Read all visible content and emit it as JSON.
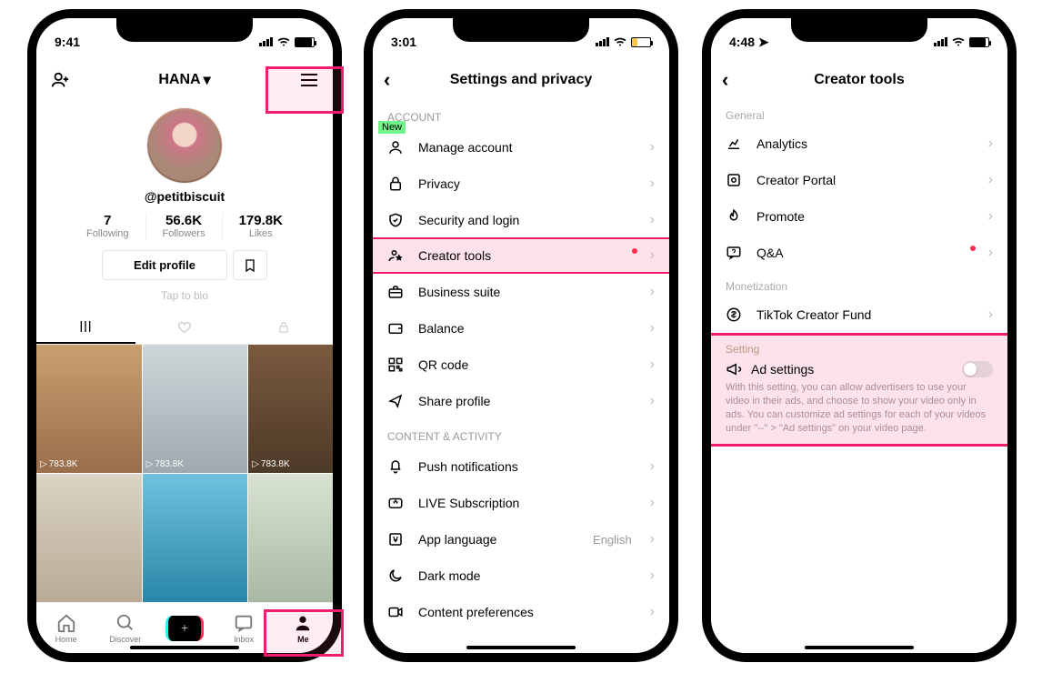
{
  "phone1": {
    "time": "9:41",
    "title": "HANA",
    "username": "@petitbiscuit",
    "stats": {
      "following_num": "7",
      "following_lab": "Following",
      "followers_num": "56.6K",
      "followers_lab": "Followers",
      "likes_num": "179.8K",
      "likes_lab": "Likes"
    },
    "edit_btn": "Edit profile",
    "bio_prompt": "Tap to bio",
    "views": "783.8K",
    "nav": {
      "home": "Home",
      "discover": "Discover",
      "inbox": "Inbox",
      "me": "Me"
    }
  },
  "phone2": {
    "time": "3:01",
    "title": "Settings and privacy",
    "new_badge": "New",
    "sec_account": "ACCOUNT",
    "rows_account": [
      {
        "icon": "person",
        "label": "Manage account"
      },
      {
        "icon": "lock",
        "label": "Privacy"
      },
      {
        "icon": "shield",
        "label": "Security and login"
      },
      {
        "icon": "star-person",
        "label": "Creator tools",
        "dot": true,
        "hl": true
      },
      {
        "icon": "briefcase",
        "label": "Business suite"
      },
      {
        "icon": "wallet",
        "label": "Balance"
      },
      {
        "icon": "qr",
        "label": "QR code"
      },
      {
        "icon": "share",
        "label": "Share profile"
      }
    ],
    "sec_content": "CONTENT & ACTIVITY",
    "rows_content": [
      {
        "icon": "bell",
        "label": "Push notifications"
      },
      {
        "icon": "live",
        "label": "LIVE Subscription"
      },
      {
        "icon": "lang",
        "label": "App language",
        "value": "English"
      },
      {
        "icon": "moon",
        "label": "Dark mode"
      },
      {
        "icon": "video",
        "label": "Content preferences"
      }
    ]
  },
  "phone3": {
    "time": "4:48",
    "title": "Creator tools",
    "sec_general": "General",
    "rows_general": [
      {
        "icon": "chart",
        "label": "Analytics"
      },
      {
        "icon": "portal",
        "label": "Creator Portal"
      },
      {
        "icon": "fire",
        "label": "Promote"
      },
      {
        "icon": "qa",
        "label": "Q&A",
        "dot": true
      }
    ],
    "sec_monet": "Monetization",
    "rows_monet": [
      {
        "icon": "dollar",
        "label": "TikTok Creator Fund"
      }
    ],
    "sec_setting": "Setting",
    "adset_label": "Ad settings",
    "adset_desc": "With this setting, you can allow advertisers to use your video in their ads, and choose to show your video only in ads. You can customize ad settings for each of your videos under  \"--\" > \"Ad settings\" on your video page."
  }
}
